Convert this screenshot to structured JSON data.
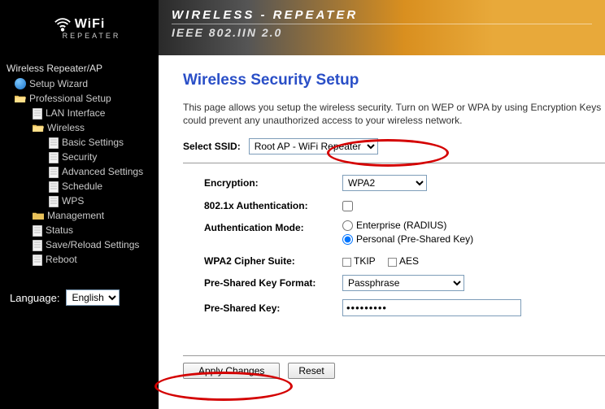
{
  "logo": {
    "main": "WiFi",
    "sub": "REPEATER"
  },
  "banner": {
    "line1": "WIRELESS - REPEATER",
    "line2": "IEEE 802.IIN 2.0"
  },
  "sidebar": {
    "root": "Wireless Repeater/AP",
    "wizard": "Setup Wizard",
    "prof": "Professional Setup",
    "lan": "LAN Interface",
    "wireless": "Wireless",
    "basic": "Basic Settings",
    "security": "Security",
    "advanced": "Advanced Settings",
    "schedule": "Schedule",
    "wps": "WPS",
    "management": "Management",
    "status": "Status",
    "savereload": "Save/Reload Settings",
    "reboot": "Reboot",
    "language_label": "Language:",
    "language_value": "English"
  },
  "main": {
    "title": "Wireless Security Setup",
    "desc": "This page allows you setup the wireless security. Turn on WEP or WPA by using Encryption Keys could prevent any unauthorized access to your wireless network.",
    "ssid_label": "Select SSID:",
    "ssid_value": "Root AP - WiFi Repeater",
    "encryption_label": "Encryption:",
    "encryption_value": "WPA2",
    "auth8021x_label": "802.1x Authentication:",
    "authmode_label": "Authentication Mode:",
    "authmode_enterprise": "Enterprise (RADIUS)",
    "authmode_personal": "Personal (Pre-Shared Key)",
    "cipher_label": "WPA2 Cipher Suite:",
    "cipher_tkip": "TKIP",
    "cipher_aes": "AES",
    "pskfmt_label": "Pre-Shared Key Format:",
    "pskfmt_value": "Passphrase",
    "psk_label": "Pre-Shared Key:",
    "psk_value": "•••••••••",
    "apply": "Apply Changes",
    "reset": "Reset"
  }
}
